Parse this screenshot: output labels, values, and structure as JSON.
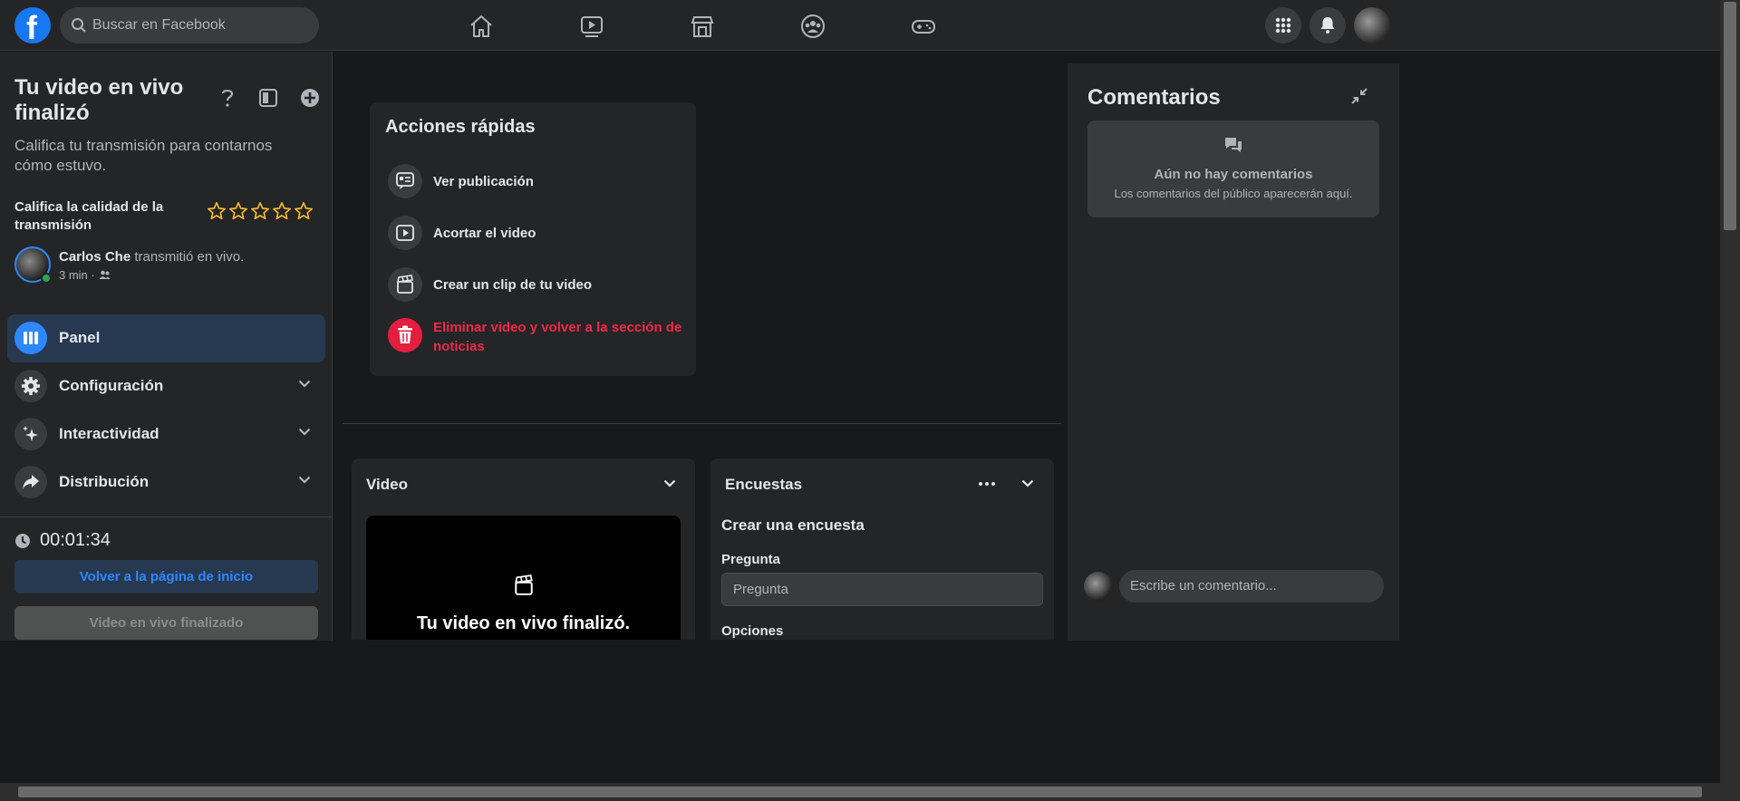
{
  "topbar": {
    "search_placeholder": "Buscar en Facebook"
  },
  "sidebar": {
    "title": "Tu video en vivo finalizó",
    "subtitle": "Califica tu transmisión para contarnos cómo estuvo.",
    "rating_label": "Califica la calidad de la transmisión",
    "rating_stars": 5,
    "streamer_name": "Carlos Che",
    "streamer_action": " transmitió en vivo.",
    "stream_time": "3 min ·",
    "menu": [
      {
        "label": "Panel",
        "icon": "panel-icon",
        "active": true
      },
      {
        "label": "Configuración",
        "icon": "gear-icon"
      },
      {
        "label": "Interactividad",
        "icon": "sparkle-icon"
      },
      {
        "label": "Distribución",
        "icon": "share-icon"
      }
    ],
    "timer": "00:01:34",
    "home_button": "Volver a la página de inicio",
    "ended_button": "Video en vivo finalizado"
  },
  "quick_actions": {
    "title": "Acciones rápidas",
    "items": [
      {
        "label": "Ver publicación",
        "icon": "post-icon"
      },
      {
        "label": "Acortar el video",
        "icon": "play-icon"
      },
      {
        "label": "Crear un clip de tu video",
        "icon": "clapper-icon"
      },
      {
        "label": "Eliminar video y volver a la sección de noticias",
        "icon": "trash-icon"
      }
    ]
  },
  "video_card": {
    "title": "Video",
    "ended_text": "Tu video en vivo finalizó."
  },
  "polls_card": {
    "title": "Encuestas",
    "create_title": "Crear una encuesta",
    "question_label": "Pregunta",
    "question_placeholder": "Pregunta",
    "options_label": "Opciones"
  },
  "comments": {
    "title": "Comentarios",
    "empty_title": "Aún no hay comentarios",
    "empty_subtitle": "Los comentarios del público aparecerán aquí.",
    "input_placeholder": "Escribe un comentario..."
  },
  "colors": {
    "brand": "#1877f2",
    "accent_link": "#2d88ff",
    "danger": "#f02849",
    "star": "#f7b928"
  }
}
